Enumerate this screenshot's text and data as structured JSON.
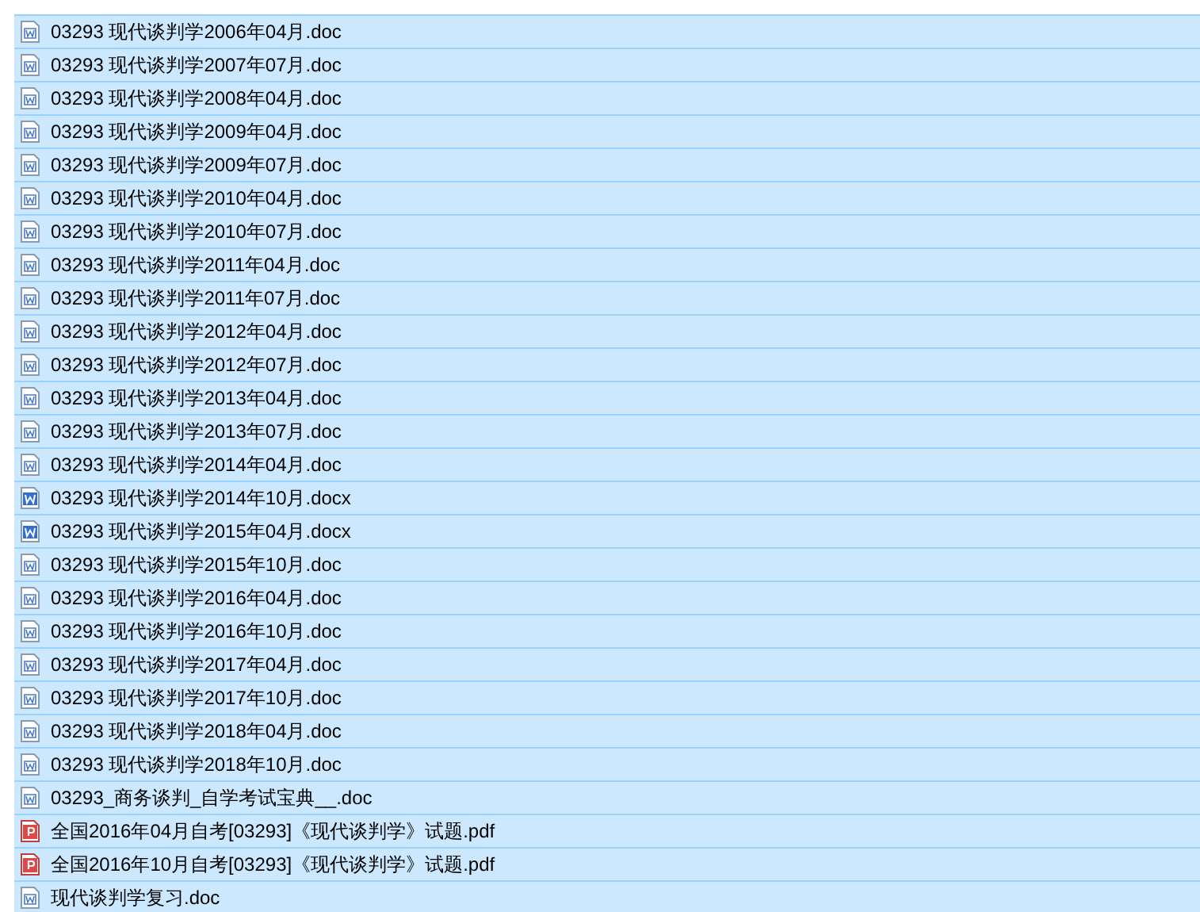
{
  "files": [
    {
      "name": "03293 现代谈判学2006年04月.doc",
      "kind": "doc",
      "selected": true
    },
    {
      "name": "03293 现代谈判学2007年07月.doc",
      "kind": "doc",
      "selected": true
    },
    {
      "name": "03293 现代谈判学2008年04月.doc",
      "kind": "doc",
      "selected": true
    },
    {
      "name": "03293 现代谈判学2009年04月.doc",
      "kind": "doc",
      "selected": true
    },
    {
      "name": "03293 现代谈判学2009年07月.doc",
      "kind": "doc",
      "selected": true
    },
    {
      "name": "03293 现代谈判学2010年04月.doc",
      "kind": "doc",
      "selected": true
    },
    {
      "name": "03293 现代谈判学2010年07月.doc",
      "kind": "doc",
      "selected": true
    },
    {
      "name": "03293 现代谈判学2011年04月.doc",
      "kind": "doc",
      "selected": true
    },
    {
      "name": "03293 现代谈判学2011年07月.doc",
      "kind": "doc",
      "selected": true
    },
    {
      "name": "03293 现代谈判学2012年04月.doc",
      "kind": "doc",
      "selected": true
    },
    {
      "name": "03293 现代谈判学2012年07月.doc",
      "kind": "doc",
      "selected": true
    },
    {
      "name": "03293 现代谈判学2013年04月.doc",
      "kind": "doc",
      "selected": true
    },
    {
      "name": "03293 现代谈判学2013年07月.doc",
      "kind": "doc",
      "selected": true
    },
    {
      "name": "03293 现代谈判学2014年04月.doc",
      "kind": "doc",
      "selected": true
    },
    {
      "name": "03293 现代谈判学2014年10月.docx",
      "kind": "docx",
      "selected": true
    },
    {
      "name": "03293 现代谈判学2015年04月.docx",
      "kind": "docx",
      "selected": true
    },
    {
      "name": "03293 现代谈判学2015年10月.doc",
      "kind": "doc",
      "selected": true
    },
    {
      "name": "03293 现代谈判学2016年04月.doc",
      "kind": "doc",
      "selected": true
    },
    {
      "name": "03293 现代谈判学2016年10月.doc",
      "kind": "doc",
      "selected": true
    },
    {
      "name": "03293 现代谈判学2017年04月.doc",
      "kind": "doc",
      "selected": true
    },
    {
      "name": "03293 现代谈判学2017年10月.doc",
      "kind": "doc",
      "selected": true
    },
    {
      "name": "03293 现代谈判学2018年04月.doc",
      "kind": "doc",
      "selected": true
    },
    {
      "name": "03293 现代谈判学2018年10月.doc",
      "kind": "doc",
      "selected": true
    },
    {
      "name": "03293_商务谈判_自学考试宝典__.doc",
      "kind": "doc",
      "selected": true
    },
    {
      "name": "全国2016年04月自考[03293]《现代谈判学》试题.pdf",
      "kind": "pdf",
      "selected": true
    },
    {
      "name": "全国2016年10月自考[03293]《现代谈判学》试题.pdf",
      "kind": "pdf",
      "selected": true
    },
    {
      "name": "现代谈判学复习.doc",
      "kind": "doc",
      "selected": true
    }
  ]
}
